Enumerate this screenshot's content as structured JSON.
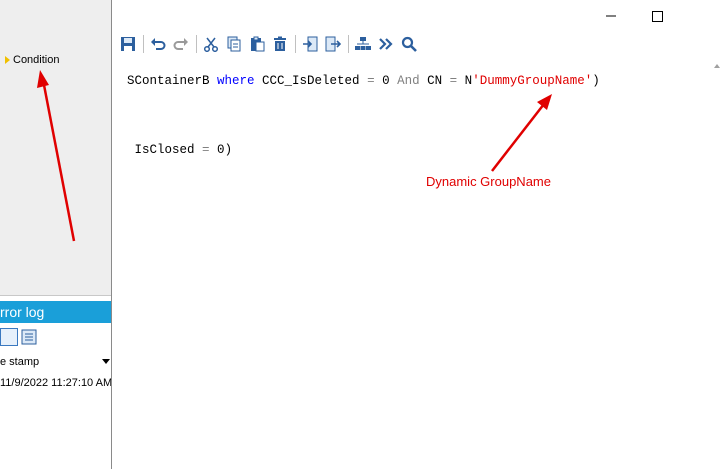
{
  "left_panel": {
    "condition_label": "Condition"
  },
  "error_log": {
    "title": "rror log",
    "column_header": "e stamp",
    "rows": [
      "11/9/2022 11:27:10 AM"
    ]
  },
  "editor": {
    "code_line1": {
      "t1": "SContainerB ",
      "kw1": "where",
      "t2": " CCC_IsDeleted ",
      "op1": "=",
      "sp1": " ",
      "n1": "0",
      "sp2": " ",
      "kw2": "And",
      "t3": " CN ",
      "op2": "=",
      "t4": " N",
      "str1": "'DummyGroupName'",
      "t5": ")"
    },
    "code_line2": {
      "t1": " IsClosed ",
      "op1": "=",
      "sp1": " ",
      "n1": "0",
      "t2": ")"
    },
    "annotation": "Dynamic GroupName",
    "toolbar_icons": [
      "save-icon",
      "undo-icon",
      "redo-icon",
      "cut-icon",
      "copy-icon",
      "paste-icon",
      "delete-icon",
      "import-icon",
      "export-icon",
      "network-icon",
      "forward-icon",
      "search-icon"
    ],
    "window_controls": [
      "minimize-icon",
      "maximize-icon"
    ]
  },
  "colors": {
    "accent": "#1a9fd9",
    "keyword": "#0000ff",
    "string": "#e00000",
    "annotation": "#e00000"
  }
}
